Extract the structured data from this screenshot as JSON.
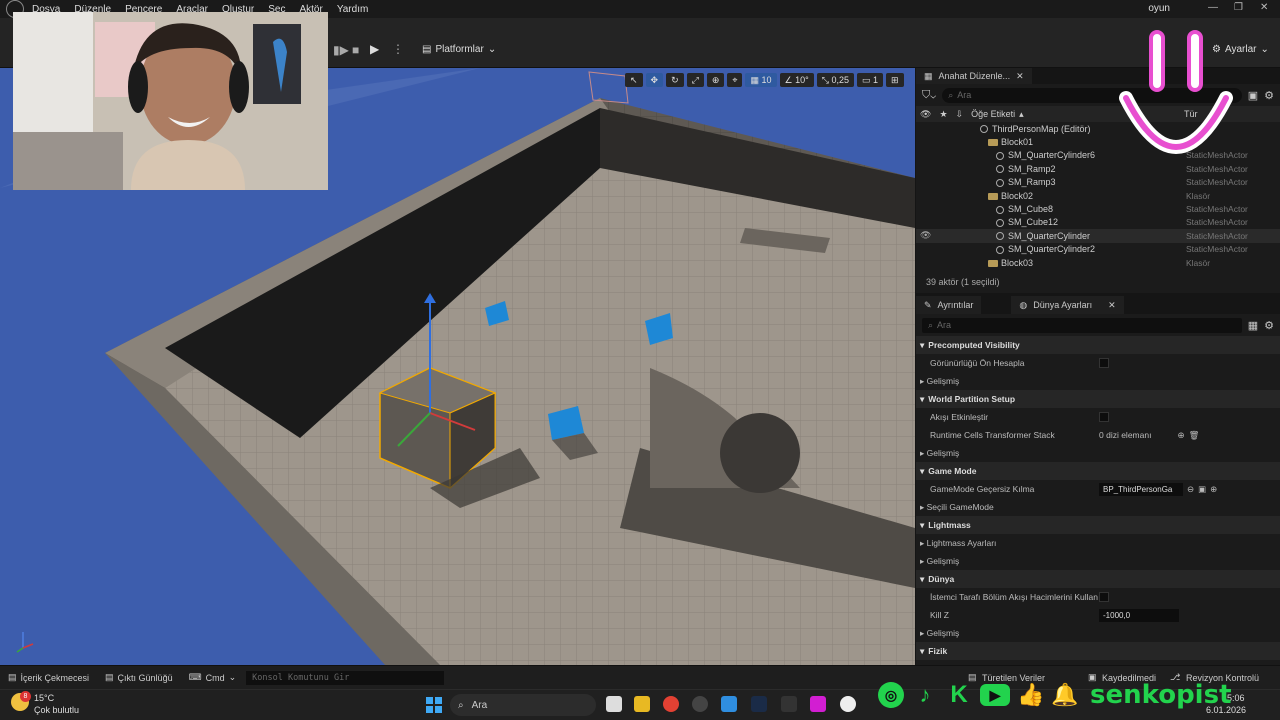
{
  "menu": [
    "Dosya",
    "Düzenle",
    "Pencere",
    "Araçlar",
    "Oluştur",
    "Seç",
    "Aktör",
    "Yardım"
  ],
  "project_name": "oyun",
  "toolbar": {
    "platforms_label": "Platformlar",
    "settings_label": "Ayarlar"
  },
  "viewport_tools": {
    "grid_snap": "10",
    "rotate_snap": "10°",
    "scale_snap": "0,25",
    "camera_speed": "1"
  },
  "outliner": {
    "tab_title": "Anahat Düzenle...",
    "search_placeholder": "Ara",
    "col_label": "Öğe Etiketi",
    "col_type": "Tür",
    "rows": [
      {
        "name": "ThirdPersonMap (Editör)",
        "type": "",
        "indent": 64,
        "kind": "map"
      },
      {
        "name": "Block01",
        "type": "",
        "indent": 72,
        "kind": "folder"
      },
      {
        "name": "SM_QuarterCylinder6",
        "type": "StaticMeshActor",
        "indent": 80,
        "kind": "mesh"
      },
      {
        "name": "SM_Ramp2",
        "type": "StaticMeshActor",
        "indent": 80,
        "kind": "mesh"
      },
      {
        "name": "SM_Ramp3",
        "type": "StaticMeshActor",
        "indent": 80,
        "kind": "mesh"
      },
      {
        "name": "Block02",
        "type": "Klasör",
        "indent": 72,
        "kind": "folder"
      },
      {
        "name": "SM_Cube8",
        "type": "StaticMeshActor",
        "indent": 80,
        "kind": "mesh"
      },
      {
        "name": "SM_Cube12",
        "type": "StaticMeshActor",
        "indent": 80,
        "kind": "mesh"
      },
      {
        "name": "SM_QuarterCylinder",
        "type": "StaticMeshActor",
        "indent": 80,
        "kind": "mesh",
        "selected": true
      },
      {
        "name": "SM_QuarterCylinder2",
        "type": "StaticMeshActor",
        "indent": 80,
        "kind": "mesh"
      },
      {
        "name": "Block03",
        "type": "Klasör",
        "indent": 72,
        "kind": "folder"
      }
    ],
    "footer": "39 aktör (1 seçildi)"
  },
  "details": {
    "tab1": "Ayrıntılar",
    "tab2": "Dünya Ayarları",
    "search_placeholder": "Ara",
    "sections": [
      {
        "title": "Precomputed Visibility",
        "rows": [
          {
            "label": "Görünürlüğü Ön Hesapla",
            "kind": "check"
          },
          {
            "label": "Gelişmiş",
            "kind": "sub"
          }
        ]
      },
      {
        "title": "World Partition Setup",
        "rows": [
          {
            "label": "Akışı Etkinleştir",
            "kind": "check"
          },
          {
            "label": "Runtime Cells Transformer Stack",
            "kind": "text",
            "value": "0 dizi elemanı"
          },
          {
            "label": "Gelişmiş",
            "kind": "sub"
          }
        ]
      },
      {
        "title": "Game Mode",
        "rows": [
          {
            "label": "GameMode Geçersiz Kılma",
            "kind": "dropdown",
            "value": "BP_ThirdPersonGa"
          },
          {
            "label": "Seçili GameMode",
            "kind": "sub"
          }
        ]
      },
      {
        "title": "Lightmass",
        "rows": [
          {
            "label": "Lightmass Ayarları",
            "kind": "sub"
          },
          {
            "label": "Gelişmiş",
            "kind": "sub"
          }
        ]
      },
      {
        "title": "Dünya",
        "rows": [
          {
            "label": "İstemci Tarafı Bölüm Akışı Hacimlerini Kullan",
            "kind": "check"
          },
          {
            "label": "Kill Z",
            "kind": "input",
            "value": "-1000,0"
          },
          {
            "label": "Gelişmiş",
            "kind": "sub"
          }
        ]
      },
      {
        "title": "Fizik",
        "rows": []
      }
    ]
  },
  "bottombar": {
    "content_drawer": "İçerik Çekmecesi",
    "output_log": "Çıktı Günlüğü",
    "cmd": "Cmd",
    "console_placeholder": "Konsol Komutunu Gir",
    "derived_data": "Türetilen Veriler",
    "saved": "Kaydedilmedi",
    "revision": "Revizyon Kontrolü"
  },
  "taskbar": {
    "temp": "15°C",
    "weather": "Çok bulutlu",
    "search": "Ara",
    "time": "15:06",
    "date": "6.01.2026",
    "badge": "8"
  },
  "overlay": {
    "channel": "senkopist"
  },
  "colors": {
    "accent_blue": "#2f5aa0",
    "social_green": "#22d34d",
    "smile_pink": "#e84fd0",
    "selection_orange": "#f2a900"
  }
}
